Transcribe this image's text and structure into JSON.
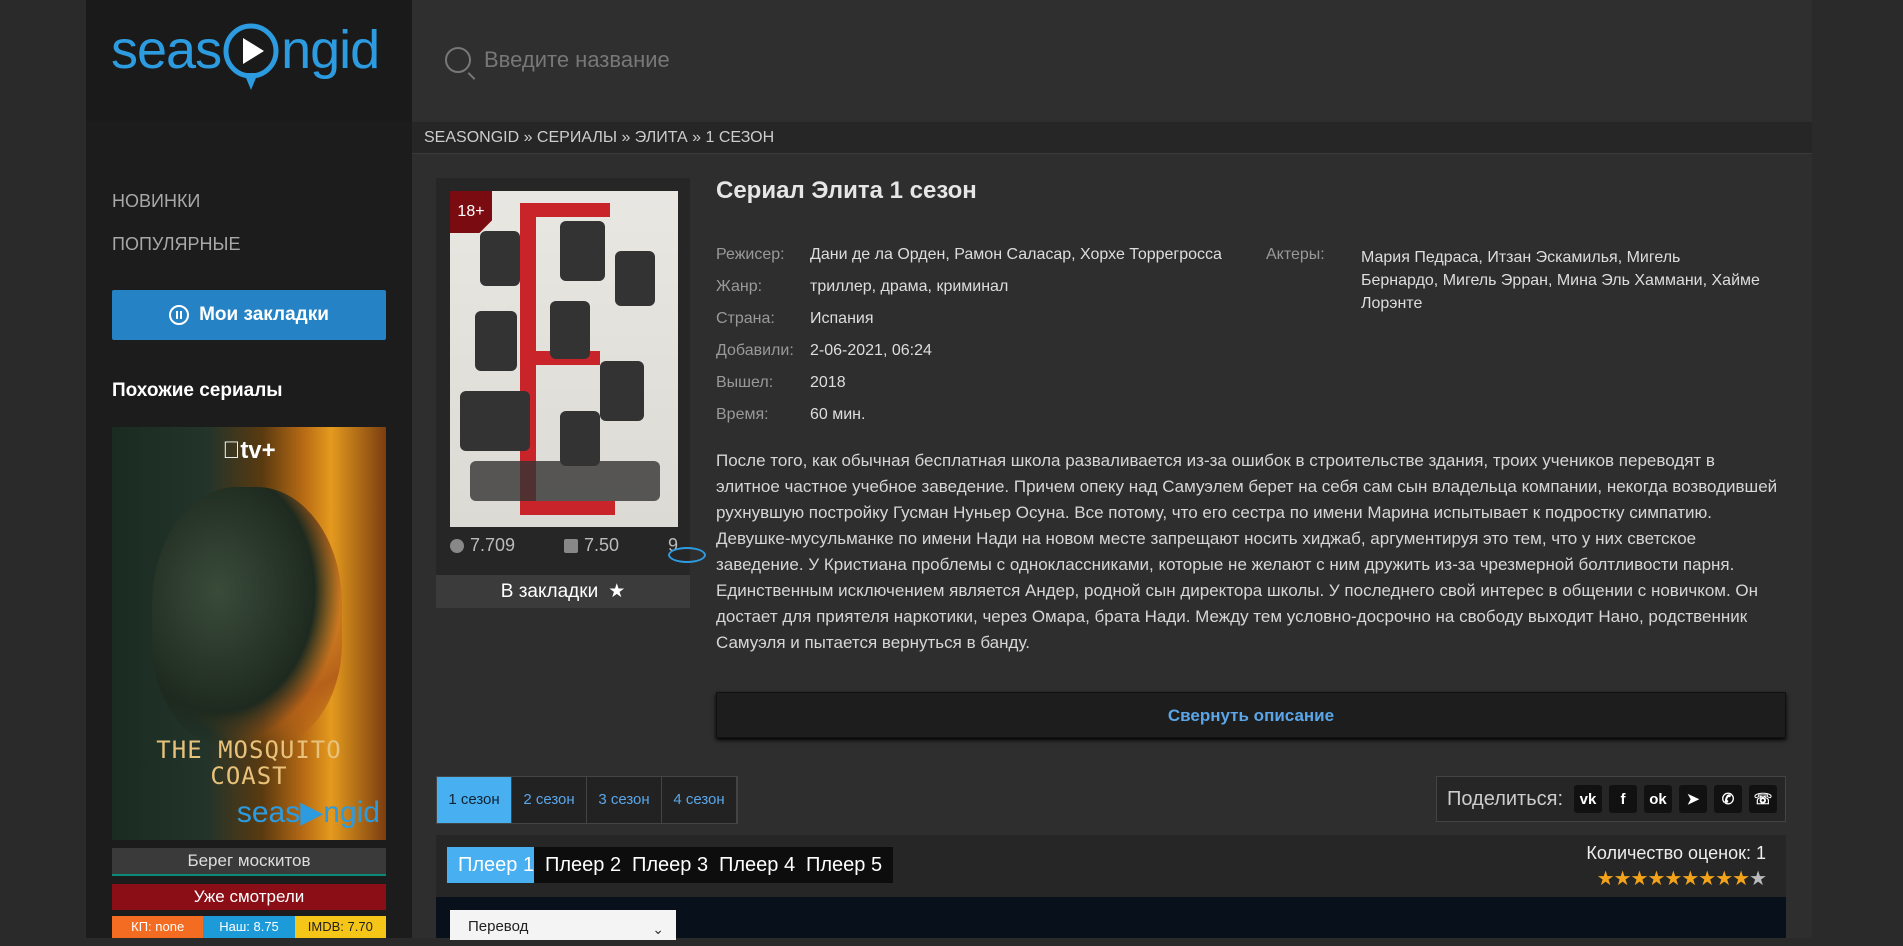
{
  "logo": {
    "left": "seas",
    "right": "ngid"
  },
  "search": {
    "placeholder": "Введите название"
  },
  "breadcrumb": "SEASONGID » СЕРИАЛЫ » ЭЛИТА » 1 СЕЗОН",
  "sidebar": {
    "nav": [
      {
        "label": "НОВИНКИ"
      },
      {
        "label": "ПОПУЛЯРНЫЕ"
      }
    ],
    "bookmarks_button": "Мои закладки",
    "similar_title": "Похожие сериалы",
    "similar": {
      "brand_badge": "tv+",
      "poster_title": "THE MOSQUITO COAST",
      "caption": "Берег москитов",
      "watched_label": "Уже смотрели",
      "ratings": {
        "kp": "КП: none",
        "ours": "Наш: 8.75",
        "imdb": "IMDB: 7.70"
      }
    }
  },
  "poster": {
    "age": "18+",
    "ratings": {
      "kp": "7.709",
      "imdb": "7.50",
      "views": "9"
    },
    "bookmark_label": "В закладки"
  },
  "show": {
    "title": "Сериал Элита 1 сезон",
    "info": [
      {
        "key": "Режисер:",
        "value": "Дани де ла Орден, Рамон Саласар, Хорхе Торрегросса"
      },
      {
        "key": "Жанр:",
        "value": "триллер, драма, криминал"
      },
      {
        "key": "Страна:",
        "value": "Испания"
      },
      {
        "key": "Добавили:",
        "value": "2-06-2021, 06:24"
      },
      {
        "key": "Вышел:",
        "value": "2018"
      },
      {
        "key": "Время:",
        "value": "60 мин."
      }
    ],
    "actors_key": "Актеры:",
    "actors": "Мария Педраса, Итзан Эскамилья, Мигель Бернардо, Мигель Эрран, Мина Эль Хаммани, Хайме Лорэнте",
    "description": "После того, как обычная бесплатная школа разваливается из-за ошибок в строительстве здания, троих учеников переводят в элитное частное учебное заведение. Причем опеку над Самуэлем берет на себя сам сын владельца компании, некогда возводившей рухнувшую постройку Гусман Нуньер Осуна. Все потому, что его сестра по имени Марина испытывает к подростку симпатию. Девушке-мусульманке по имени Нади на новом месте запрещают носить хиджаб, аргументируя это тем, что у них светское заведение. У Кристиана проблемы с одноклассниками, которые не желают с ним дружить из-за чрезмерной болтливости парня. Единственным исключением является Андер, родной сын директора школы. У последнего свой интерес в общении с новичком. Он достает для приятеля наркотики, через Омара, брата Нади. Между тем условно-досрочно на свободу выходит Нано, родственник Самуэля и пытается вернуться в банду.",
    "collapse_label": "Свернуть описание"
  },
  "seasons": [
    {
      "label": "1 сезон",
      "active": true
    },
    {
      "label": "2 сезон"
    },
    {
      "label": "3 сезон"
    },
    {
      "label": "4 сезон"
    }
  ],
  "share": {
    "label": "Поделиться:",
    "buttons": [
      {
        "name": "vk-icon",
        "glyph": "vk"
      },
      {
        "name": "facebook-icon",
        "glyph": "f"
      },
      {
        "name": "odnoklassniki-icon",
        "glyph": "ok"
      },
      {
        "name": "telegram-icon",
        "glyph": "➤"
      },
      {
        "name": "viber-icon",
        "glyph": "✆"
      },
      {
        "name": "whatsapp-icon",
        "glyph": "☏"
      }
    ]
  },
  "players": [
    {
      "label": "Плеер 1",
      "active": true
    },
    {
      "label": "Плеер 2"
    },
    {
      "label": "Плеер 3"
    },
    {
      "label": "Плеер 4"
    },
    {
      "label": "Плеер 5"
    }
  ],
  "rating": {
    "votes_label": "Количество оценок: 1",
    "stars_filled": 9,
    "stars_total": 10
  },
  "translation_select": {
    "value": "Перевод"
  },
  "colors": {
    "accent": "#2582c4",
    "active_tab": "#48b0f0",
    "watched": "#8b0e16",
    "kp": "#f36c21",
    "ours": "#1d9bd8",
    "imdb": "#f5c518"
  }
}
